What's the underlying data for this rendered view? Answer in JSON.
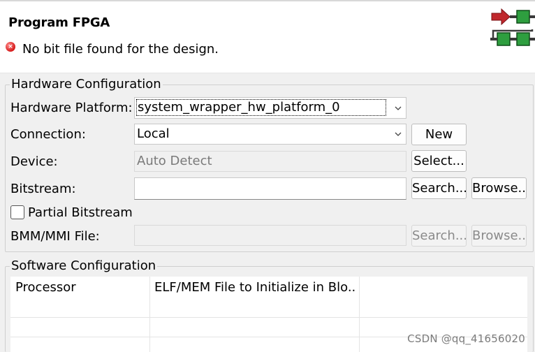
{
  "header": {
    "title": "Program FPGA",
    "message": "No bit file found for the design."
  },
  "hardware_configuration": {
    "label": "Hardware Configuration",
    "platform_label": "Hardware Platform:",
    "platform_value": "system_wrapper_hw_platform_0",
    "connection_label": "Connection:",
    "connection_value": "Local",
    "new_button": "New",
    "device_label": "Device:",
    "device_value": "Auto Detect",
    "select_button": "Select...",
    "bitstream_label": "Bitstream:",
    "bitstream_value": "",
    "bitstream_search_button": "Search...",
    "bitstream_browse_button": "Browse..",
    "partial_bitstream_label": "Partial Bitstream",
    "partial_bitstream_checked": false,
    "bmm_label": "BMM/MMI File:",
    "bmm_value": "",
    "bmm_search_button": "Search...",
    "bmm_browse_button": "Browse.."
  },
  "software_configuration": {
    "label": "Software Configuration",
    "columns": [
      "Processor",
      "ELF/MEM File to Initialize in Blo..."
    ]
  },
  "watermark": "CSDN @qq_41656020",
  "colors": {
    "error": "#d61a1a",
    "logo_arrow": "#c0282d",
    "logo_block": "#2e9e3f"
  }
}
